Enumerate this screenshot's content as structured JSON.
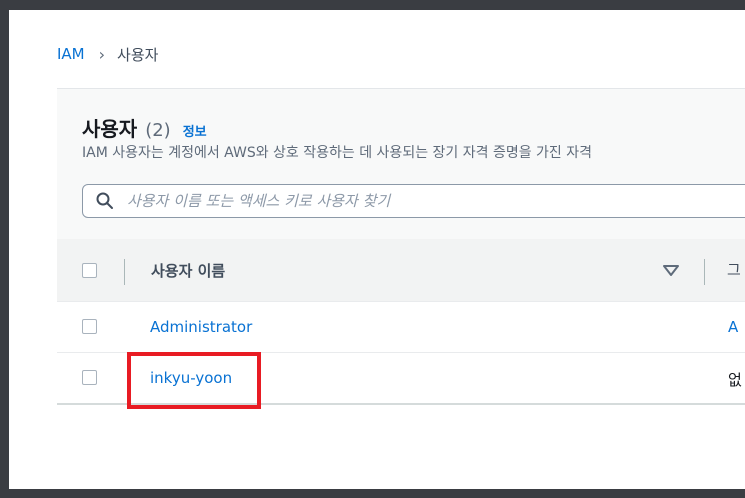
{
  "breadcrumb": {
    "root": "IAM",
    "separator": "›",
    "current": "사용자"
  },
  "header": {
    "title": "사용자",
    "count": "(2)",
    "info": "정보",
    "description": "IAM 사용자는 계정에서 AWS와 상호 작용하는 데 사용되는 장기 자격 증명을 가진 자격"
  },
  "search": {
    "placeholder": "사용자 이름 또는 액세스 키로 사용자 찾기",
    "value": ""
  },
  "table": {
    "column_user_name": "사용자 이름",
    "column_next_partial": "그",
    "rows": [
      {
        "user_name": "Administrator",
        "next_partial": "A"
      },
      {
        "user_name": "inkyu-yoon",
        "next_partial": "없"
      }
    ]
  },
  "colors": {
    "accent": "#0972d3",
    "highlight": "#e81b23"
  },
  "icons": {
    "search": "search-icon",
    "sort": "caret-down-icon",
    "separator": "chevron-right-icon"
  }
}
